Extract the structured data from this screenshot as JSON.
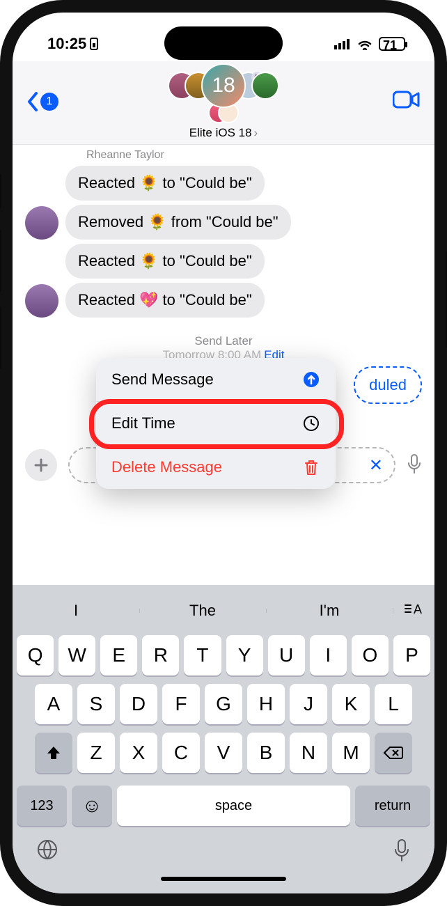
{
  "status": {
    "time": "10:25",
    "battery_pct": "71"
  },
  "header": {
    "back_count": "1",
    "chat_name": "Elite iOS 18",
    "big_avatar_label": "18"
  },
  "sender": "Rheanne Taylor",
  "messages": [
    "Reacted 🌻 to \"Could be\"",
    "Removed 🌻 from \"Could be\"",
    "Reacted 🌻 to \"Could be\"",
    "Reacted 💖 to \"Could be\""
  ],
  "send_later": {
    "title": "Send Later",
    "time": "Tomorrow 8:00 AM",
    "edit": "Edit"
  },
  "scheduled_fragment": "duled",
  "menu": {
    "send": "Send Message",
    "edit_time": "Edit Time",
    "delete": "Delete Message"
  },
  "keyboard": {
    "predict": [
      "I",
      "The",
      "I'm"
    ],
    "row1": [
      "Q",
      "W",
      "E",
      "R",
      "T",
      "Y",
      "U",
      "I",
      "O",
      "P"
    ],
    "row2": [
      "A",
      "S",
      "D",
      "F",
      "G",
      "H",
      "J",
      "K",
      "L"
    ],
    "row3": [
      "Z",
      "X",
      "C",
      "V",
      "B",
      "N",
      "M"
    ],
    "numkey": "123",
    "space": "space",
    "return": "return"
  }
}
